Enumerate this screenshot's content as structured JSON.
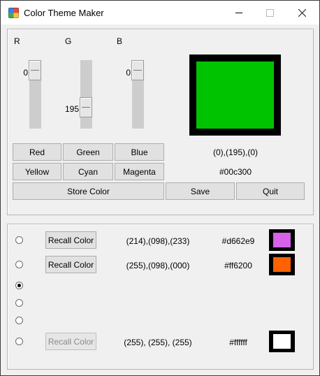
{
  "window": {
    "title": "Color Theme Maker",
    "icon": "color-wheel-icon",
    "controls": [
      "minimize-icon",
      "maximize-icon",
      "close-icon"
    ]
  },
  "picker": {
    "channels": [
      {
        "label": "R",
        "value": "0",
        "level": 0
      },
      {
        "label": "G",
        "value": "195",
        "level": 0.765
      },
      {
        "label": "B",
        "value": "0",
        "level": 0
      }
    ],
    "preview_color": "#00c300",
    "rgb_text": "(0),(195),(0)",
    "hex_text": "#00c300",
    "preset_buttons": [
      "Red",
      "Green",
      "Blue",
      "Yellow",
      "Cyan",
      "Magenta"
    ],
    "store_label": "Store Color",
    "save_label": "Save",
    "quit_label": "Quit"
  },
  "stored": {
    "recall_label": "Recall Color",
    "selected_index": 2,
    "rows": [
      {
        "rgb": "(214),(098),(233)",
        "hex": "#d662e9",
        "color": "#d662e9",
        "enabled": true
      },
      {
        "rgb": "(255),(098),(000)",
        "hex": "#ff6200",
        "color": "#ff6200",
        "enabled": true
      },
      {
        "rgb": "",
        "hex": "",
        "color": "",
        "enabled": false
      },
      {
        "rgb": "",
        "hex": "",
        "color": "",
        "enabled": false
      },
      {
        "rgb": "",
        "hex": "",
        "color": "",
        "enabled": false
      },
      {
        "rgb": "(255), (255), (255)",
        "hex": "#ffffff",
        "color": "#ffffff",
        "enabled": false
      }
    ]
  }
}
